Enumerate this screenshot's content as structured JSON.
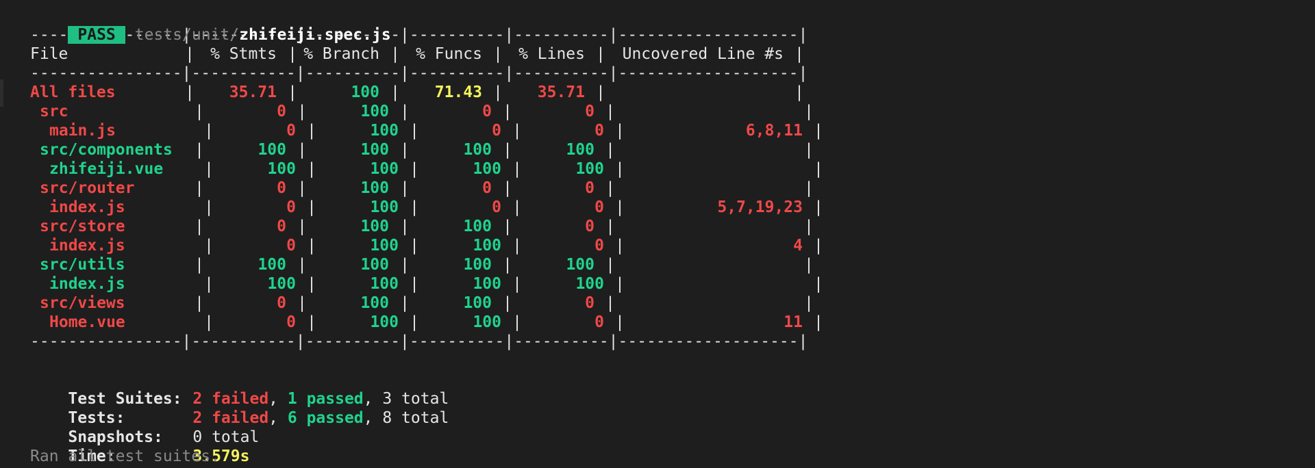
{
  "header": {
    "badge": "PASS",
    "path_dir": "tests/unit/",
    "path_file": "zhifeiji.spec.js"
  },
  "table": {
    "divider": "----------------|-----------|----------|----------|----------|-------------------|",
    "columns": [
      "File",
      "% Stmts",
      "% Branch",
      "% Funcs",
      "% Lines",
      "Uncovered Line #s"
    ],
    "rows": [
      {
        "file": "All files",
        "indent": 0,
        "file_color": "red",
        "stmts": "35.71",
        "stmts_color": "red",
        "branch": "100",
        "branch_color": "green",
        "funcs": "71.43",
        "funcs_color": "yellow",
        "lines": "35.71",
        "lines_color": "red",
        "uncovered": "",
        "uncovered_color": "red"
      },
      {
        "file": "src",
        "indent": 1,
        "file_color": "red",
        "stmts": "0",
        "stmts_color": "red",
        "branch": "100",
        "branch_color": "green",
        "funcs": "0",
        "funcs_color": "red",
        "lines": "0",
        "lines_color": "red",
        "uncovered": "",
        "uncovered_color": "red"
      },
      {
        "file": "main.js",
        "indent": 2,
        "file_color": "red",
        "stmts": "0",
        "stmts_color": "red",
        "branch": "100",
        "branch_color": "green",
        "funcs": "0",
        "funcs_color": "red",
        "lines": "0",
        "lines_color": "red",
        "uncovered": "6,8,11",
        "uncovered_color": "red"
      },
      {
        "file": "src/components",
        "indent": 1,
        "file_color": "green",
        "stmts": "100",
        "stmts_color": "green",
        "branch": "100",
        "branch_color": "green",
        "funcs": "100",
        "funcs_color": "green",
        "lines": "100",
        "lines_color": "green",
        "uncovered": "",
        "uncovered_color": "green"
      },
      {
        "file": "zhifeiji.vue",
        "indent": 2,
        "file_color": "green",
        "stmts": "100",
        "stmts_color": "green",
        "branch": "100",
        "branch_color": "green",
        "funcs": "100",
        "funcs_color": "green",
        "lines": "100",
        "lines_color": "green",
        "uncovered": "",
        "uncovered_color": "green"
      },
      {
        "file": "src/router",
        "indent": 1,
        "file_color": "red",
        "stmts": "0",
        "stmts_color": "red",
        "branch": "100",
        "branch_color": "green",
        "funcs": "0",
        "funcs_color": "red",
        "lines": "0",
        "lines_color": "red",
        "uncovered": "",
        "uncovered_color": "red"
      },
      {
        "file": "index.js",
        "indent": 2,
        "file_color": "red",
        "stmts": "0",
        "stmts_color": "red",
        "branch": "100",
        "branch_color": "green",
        "funcs": "0",
        "funcs_color": "red",
        "lines": "0",
        "lines_color": "red",
        "uncovered": "5,7,19,23",
        "uncovered_color": "red"
      },
      {
        "file": "src/store",
        "indent": 1,
        "file_color": "red",
        "stmts": "0",
        "stmts_color": "red",
        "branch": "100",
        "branch_color": "green",
        "funcs": "100",
        "funcs_color": "green",
        "lines": "0",
        "lines_color": "red",
        "uncovered": "",
        "uncovered_color": "red"
      },
      {
        "file": "index.js",
        "indent": 2,
        "file_color": "red",
        "stmts": "0",
        "stmts_color": "red",
        "branch": "100",
        "branch_color": "green",
        "funcs": "100",
        "funcs_color": "green",
        "lines": "0",
        "lines_color": "red",
        "uncovered": "4",
        "uncovered_color": "red"
      },
      {
        "file": "src/utils",
        "indent": 1,
        "file_color": "green",
        "stmts": "100",
        "stmts_color": "green",
        "branch": "100",
        "branch_color": "green",
        "funcs": "100",
        "funcs_color": "green",
        "lines": "100",
        "lines_color": "green",
        "uncovered": "",
        "uncovered_color": "green"
      },
      {
        "file": "index.js",
        "indent": 2,
        "file_color": "green",
        "stmts": "100",
        "stmts_color": "green",
        "branch": "100",
        "branch_color": "green",
        "funcs": "100",
        "funcs_color": "green",
        "lines": "100",
        "lines_color": "green",
        "uncovered": "",
        "uncovered_color": "green"
      },
      {
        "file": "src/views",
        "indent": 1,
        "file_color": "red",
        "stmts": "0",
        "stmts_color": "red",
        "branch": "100",
        "branch_color": "green",
        "funcs": "100",
        "funcs_color": "green",
        "lines": "0",
        "lines_color": "red",
        "uncovered": "",
        "uncovered_color": "red"
      },
      {
        "file": "Home.vue",
        "indent": 2,
        "file_color": "red",
        "stmts": "0",
        "stmts_color": "red",
        "branch": "100",
        "branch_color": "green",
        "funcs": "100",
        "funcs_color": "green",
        "lines": "0",
        "lines_color": "red",
        "uncovered": "11",
        "uncovered_color": "red"
      }
    ]
  },
  "summary": {
    "suites": {
      "label": "Test Suites:",
      "failed": "2 failed",
      "passed": "1 passed",
      "total": "3 total"
    },
    "tests": {
      "label": "Tests:",
      "failed": "2 failed",
      "passed": "6 passed",
      "total": "8 total"
    },
    "snapshots": {
      "label": "Snapshots:",
      "total": "0 total"
    },
    "time": {
      "label": "Time:",
      "value": "3.579s"
    },
    "footer": "Ran all test suites."
  },
  "colors": {
    "background": "#1e1e1e",
    "pass": "#1fbf84",
    "green": "#1fd38e",
    "red": "#f04848",
    "yellow": "#f5f35a",
    "gray": "#8a8a8a"
  }
}
